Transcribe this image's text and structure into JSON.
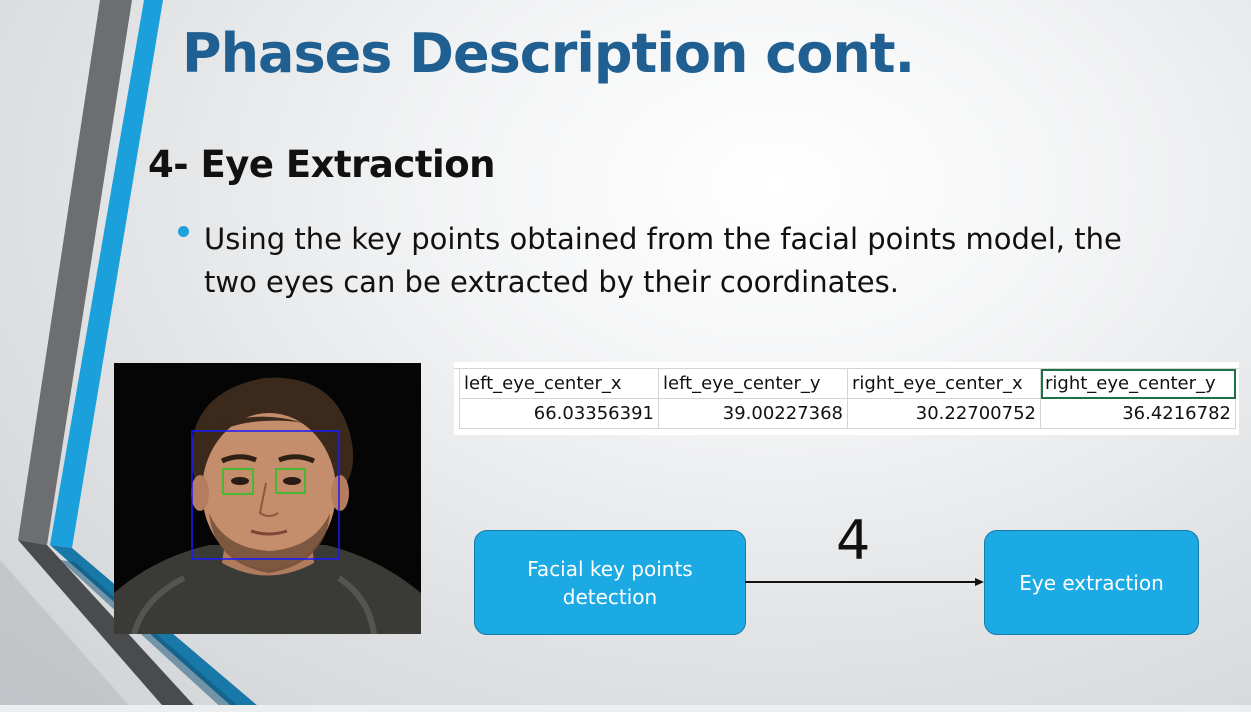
{
  "slide": {
    "title": "Phases Description cont.",
    "subtitle": "4- Eye Extraction",
    "bullet": "Using the key points obtained from the facial points model, the two eyes can be extracted by their coordinates."
  },
  "keypoints_table": {
    "headers": [
      "left_eye_center_x",
      "left_eye_center_y",
      "right_eye_center_x",
      "right_eye_center_y"
    ],
    "values": [
      "66.03356391",
      "39.00227368",
      "30.22700752",
      "36.4216782"
    ]
  },
  "flow": {
    "box_a": "Facial key points detection",
    "box_b": "Eye extraction",
    "step_number": "4"
  },
  "colors": {
    "title": "#1f5f91",
    "accent_blue": "#1ea1dc",
    "box_fill": "#1caae4",
    "face_box": "#1a1aff",
    "eye_box": "#22c322"
  }
}
